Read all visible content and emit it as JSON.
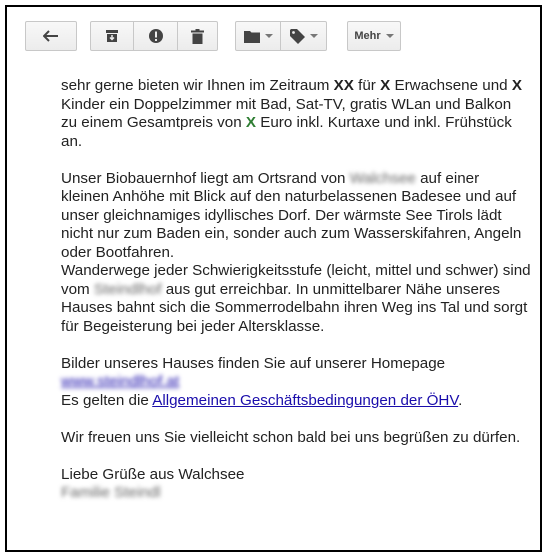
{
  "toolbar": {
    "back_icon": "arrow-left-icon",
    "archive_icon": "archive-icon",
    "spam_icon": "report-spam-icon",
    "delete_icon": "trash-icon",
    "move_icon": "folder-icon",
    "labels_icon": "tag-icon",
    "more_label": "Mehr"
  },
  "email": {
    "p1": {
      "t1": "sehr gerne bieten wir Ihnen im Zeitraum ",
      "x1": "XX",
      "t2": " für ",
      "x2": "X",
      "t3": " Erwachsene und ",
      "x3": "X",
      "t4": " Kinder ein Doppelzimmer mit Bad, Sat-TV, gratis WLan und Balkon zu einem Gesamtpreis von ",
      "x4": "X",
      "t5": " Euro inkl. Kurtaxe und inkl. Frühstück an."
    },
    "p2": {
      "t1": "Unser Biobauernhof liegt am Ortsrand von ",
      "blur1": "Walchsee",
      "t2": " auf einer kleinen Anhöhe mit Blick auf den naturbelassenen Badesee und auf unser gleichnamiges idyllisches Dorf. Der wärmste See Tirols lädt nicht nur zum Baden ein, sonder auch zum Wasserskifahren, Angeln oder Bootfahren.",
      "t3": "Wanderwege jeder Schwierigkeitsstufe (leicht, mittel und schwer) sind vom ",
      "blur2": "Steindlhof",
      "t4": " aus gut erreichbar. In unmittelbarer Nähe unseres Hauses bahnt sich die Sommerrodelbahn ihren Weg ins Tal und sorgt für Begeisterung bei jeder Altersklasse."
    },
    "p3": {
      "t1": "Bilder unseres Hauses finden Sie auf unserer Homepage",
      "homepage_link": "www.steindlhof.at",
      "t2": "Es gelten die ",
      "agb_link": "Allgemeinen Geschäftsbedingungen der ÖHV",
      "t3": "."
    },
    "p4": "Wir freuen uns Sie vielleicht schon bald bei uns begrüßen zu dürfen.",
    "p5": {
      "greeting": "Liebe Grüße aus Walchsee",
      "signature": "Familie Steindl"
    }
  }
}
